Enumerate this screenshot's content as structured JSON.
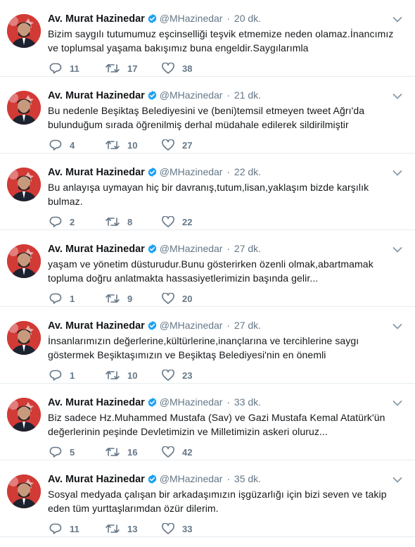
{
  "account": {
    "name": "Av. Murat Hazinedar",
    "handle": "@MHazinedar",
    "separator": "·"
  },
  "tweets": [
    {
      "time": "20 dk.",
      "text": "Bizim saygılı tutumumuz eşcinselliği teşvik etmemize neden olamaz.İnancımız ve toplumsal yaşama bakışımız buna engeldir.Saygılarımla",
      "replies": "11",
      "retweets": "17",
      "likes": "38"
    },
    {
      "time": "21 dk.",
      "text": "Bu nedenle Beşiktaş Belediyesini ve (beni)temsil etmeyen tweet Ağrı'da bulunduğum sırada öğrenilmiş derhal müdahale edilerek sildirilmiştir",
      "replies": "4",
      "retweets": "10",
      "likes": "27"
    },
    {
      "time": "22 dk.",
      "text": "Bu anlayışa uymayan hiç bir davranış,tutum,lisan,yaklaşım bizde karşılık bulmaz.",
      "replies": "2",
      "retweets": "8",
      "likes": "22"
    },
    {
      "time": "27 dk.",
      "text": "yaşam ve yönetim düsturudur.Bunu gösterirken özenli olmak,abartmamak topluma doğru anlatmakta hassasiyetlerimizin başında gelir...",
      "replies": "1",
      "retweets": "9",
      "likes": "20"
    },
    {
      "time": "27 dk.",
      "text": "İnsanlarımızın değerlerine,kültürlerine,inançlarına ve tercihlerine saygı göstermek Beşiktaşımızın ve Beşiktaş Belediyesi'nin en önemli",
      "replies": "1",
      "retweets": "10",
      "likes": "23"
    },
    {
      "time": "33 dk.",
      "text": "Biz sadece Hz.Muhammed Mustafa (Sav) ve Gazi Mustafa Kemal Atatürk'ün değerlerinin peşinde Devletimizin ve Milletimizin askeri oluruz...",
      "replies": "5",
      "retweets": "16",
      "likes": "42"
    },
    {
      "time": "35 dk.",
      "text": "Sosyal medyada çalışan bir arkadaşımızın işgüzarlığı için bizi seven ve takip eden tüm yurttaşlarımdan özür dilerim.",
      "replies": "11",
      "retweets": "13",
      "likes": "33"
    }
  ],
  "colors": {
    "text": "#14171a",
    "muted": "#657786",
    "verified": "#1da1f2",
    "divider": "#e6ecf0"
  },
  "icons": [
    "reply-icon",
    "retweet-icon",
    "like-icon",
    "verified-badge-icon",
    "chevron-down-icon"
  ]
}
